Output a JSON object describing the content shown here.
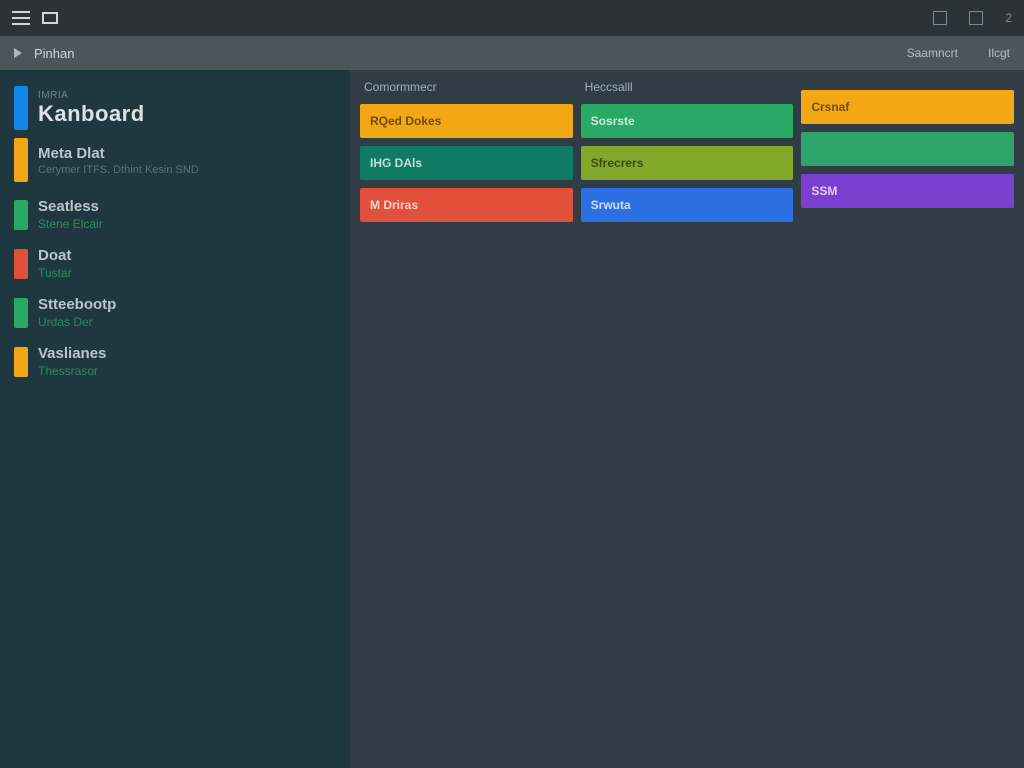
{
  "titlebar": {
    "count": "2"
  },
  "breadcrumb": {
    "label": "Pinhan",
    "link_a": "Saamncrt",
    "link_b": "Ilcgt"
  },
  "sidebar": {
    "app": {
      "eyebrow": "IMRIA",
      "title": "Kanboard",
      "chip": "#0f86e8"
    },
    "items": [
      {
        "title": "Meta Dlat",
        "sub": "Cerymer ITFS. Dthint Kesin SND",
        "chip": "#f2a815"
      },
      {
        "title": "Seatless",
        "sub": "Stene Elcair",
        "chip": "#2aa866"
      },
      {
        "title": "Doat",
        "sub": "Tustar",
        "chip": "#e0503a"
      },
      {
        "title": "Stteebootp",
        "sub": "Urdas Der",
        "chip": "#2aa866"
      },
      {
        "title": "Vaslianes",
        "sub": "Thessrasor",
        "chip": "#f2a815"
      }
    ]
  },
  "board": {
    "columns": [
      {
        "header": "Comormmecr",
        "cards": [
          {
            "label": "RQed Dokes",
            "color": "#f2a815",
            "light": false
          },
          {
            "label": "IHG DAls",
            "color": "#0f7b63",
            "light": true
          },
          {
            "label": "M Driras",
            "color": "#e0503a",
            "light": true
          }
        ]
      },
      {
        "header": "Heccsalll",
        "cards": [
          {
            "label": "Sosrste",
            "color": "#2aa866",
            "light": true
          },
          {
            "label": "Sfrecrers",
            "color": "#82a82a",
            "light": false
          },
          {
            "label": "Srwuta",
            "color": "#2b6fe0",
            "light": true
          }
        ]
      },
      {
        "header": "",
        "cards": [
          {
            "label": "Crsnaf",
            "color": "#f2a815",
            "light": false
          },
          {
            "label": "",
            "color": "#2ea46a",
            "light": true
          },
          {
            "label": "SSM",
            "color": "#7b3fcf",
            "light": true
          }
        ]
      }
    ]
  }
}
